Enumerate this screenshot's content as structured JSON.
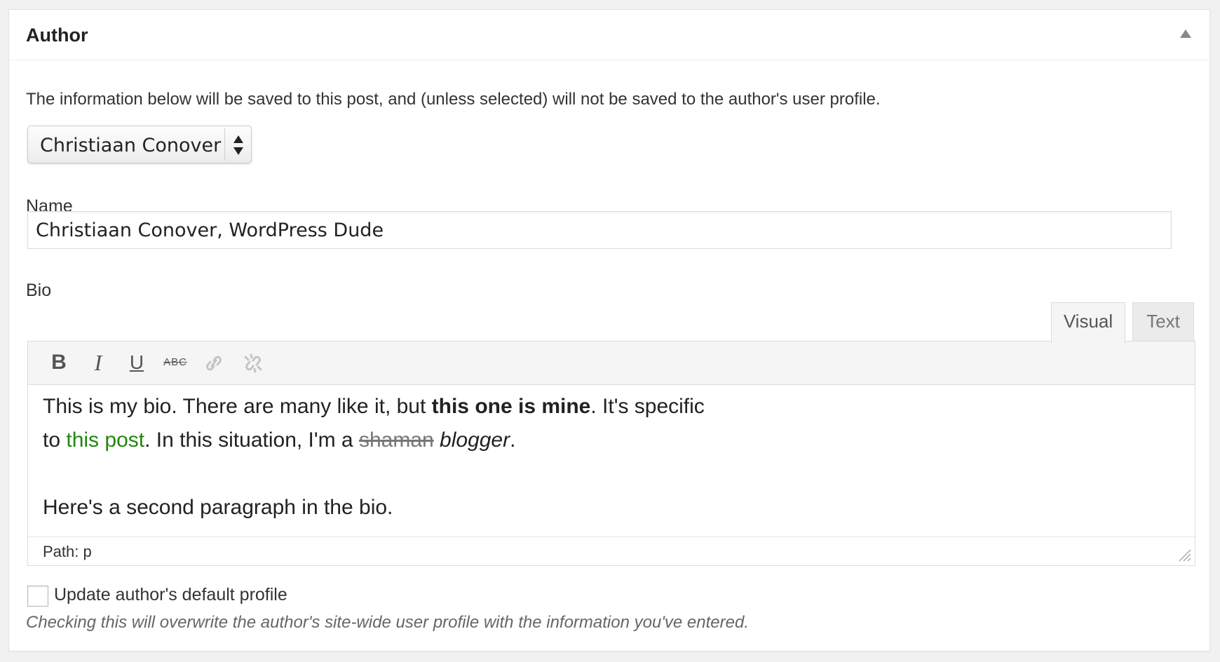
{
  "metabox": {
    "title": "Author",
    "toggle_icon": "arrow-up-icon"
  },
  "intro_text": "The information below will be saved to this post, and (unless selected) will not be saved to the author's user profile.",
  "author_select": {
    "selected": "Christiaan Conover"
  },
  "name_field": {
    "label": "Name",
    "value": "Christiaan Conover, WordPress Dude"
  },
  "bio_field": {
    "label": "Bio",
    "tabs": [
      {
        "label": "Visual",
        "active": true
      },
      {
        "label": "Text",
        "active": false
      }
    ],
    "toolbar": {
      "bold": "B",
      "italic": "I",
      "underline": "U",
      "strikethrough": "ABC",
      "link_icon": "link-icon",
      "unlink_icon": "unlink-icon"
    },
    "content": {
      "p1_text1": "This is my bio. There are many like it, but ",
      "p1_bold": "this one is mine",
      "p1_text2": ". It's specific to ",
      "p1_link": "this post",
      "p1_text3": ". In this situation, I'm a ",
      "p1_strike": "shaman",
      "p1_space": " ",
      "p1_italic": "blogger",
      "p1_end": ".",
      "p2": "Here's a second paragraph in the bio."
    },
    "path": "Path: p"
  },
  "update_profile": {
    "label": "Update author's default profile",
    "checked": false,
    "description": "Checking this will overwrite the author's site-wide user profile with the information you've entered."
  },
  "colors": {
    "link": "#21870e",
    "background": "#f1f1f1",
    "panel": "#ffffff"
  }
}
